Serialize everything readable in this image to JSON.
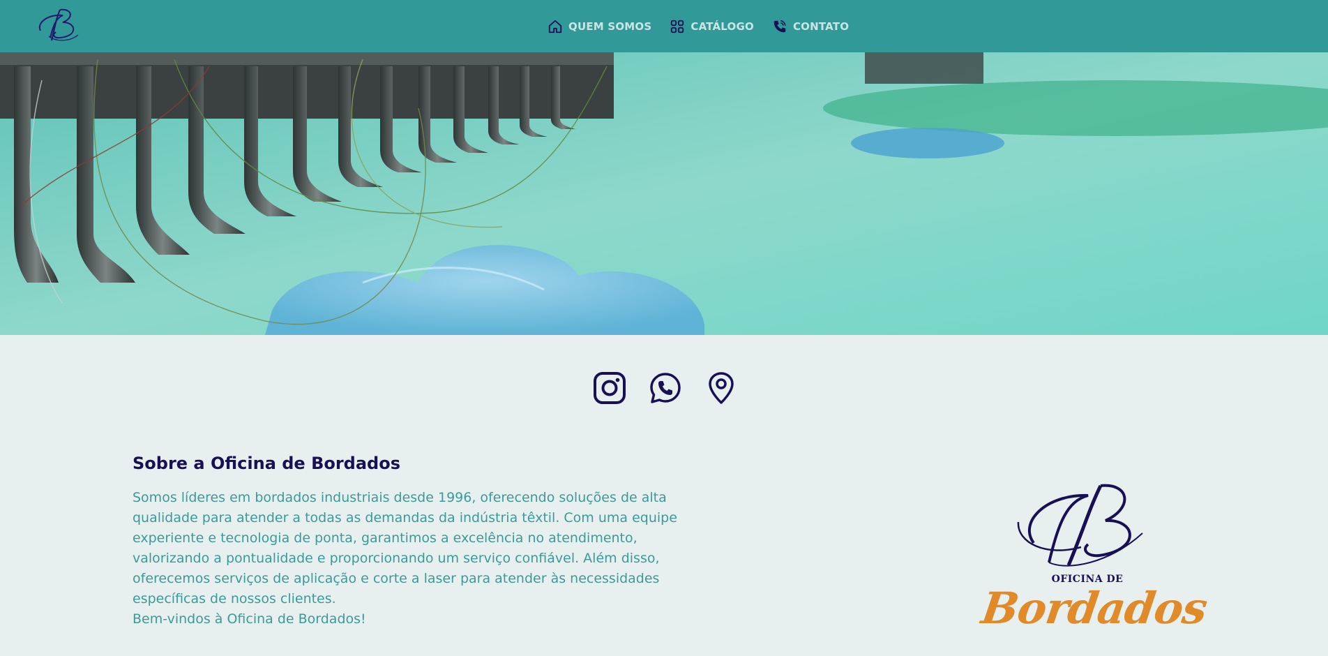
{
  "nav": {
    "items": [
      {
        "label": "QUEM SOMOS",
        "icon": "home-icon"
      },
      {
        "label": "CATÁLOGO",
        "icon": "grid-icon"
      },
      {
        "label": "CONTATO",
        "icon": "phone-icon"
      }
    ]
  },
  "hero": {
    "image": "embroidery-machine-photo",
    "slides": 5
  },
  "social": [
    "instagram-icon",
    "whatsapp-icon",
    "location-pin-icon"
  ],
  "about": {
    "title": "Sobre a Oficina de Bordados",
    "paragraph": "Somos líderes em bordados industriais desde 1996, oferecendo soluções de alta qualidade para atender a todas as demandas da indústria têxtil. Com uma equipe experiente e tecnologia de ponta, garantimos a excelência no atendimento, valorizando a pontualidade e proporcionando um serviço confiável. Além disso, oferecemos serviços de aplicação e corte a laser para atender às necessidades específicas de nossos clientes.",
    "welcome": "Bem-vindos à Oficina de Bordados!"
  },
  "brand": {
    "line1": "OFICINA DE",
    "line2": "Bordados"
  },
  "colors": {
    "nav_bg": "#329999",
    "navy": "#180f55",
    "teal_text": "#3a9a9a",
    "orange": "#e08a2a",
    "page_bg": "#e8f0ef"
  }
}
